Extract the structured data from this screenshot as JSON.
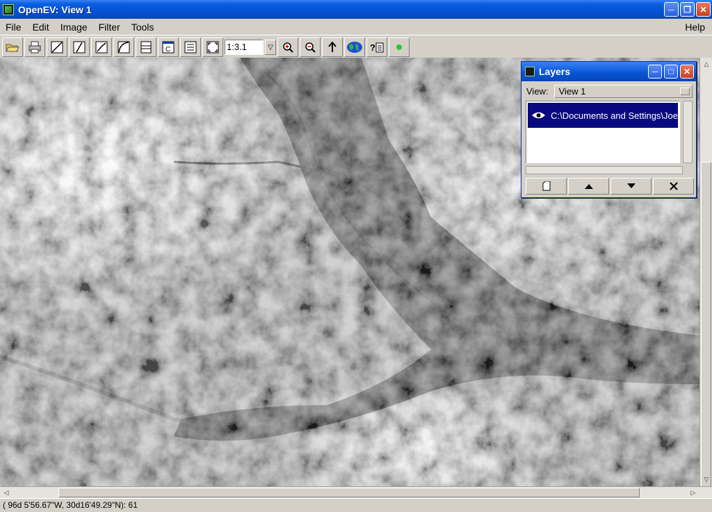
{
  "window": {
    "title": "OpenEV: View 1"
  },
  "menu": {
    "items": [
      "File",
      "Edit",
      "Image",
      "Filter",
      "Tools"
    ],
    "help": "Help"
  },
  "toolbar": {
    "zoom_value": "1:3.1",
    "buttons": [
      "open-icon",
      "print-icon",
      "draw-point-icon",
      "draw-line-icon",
      "draw-polygon-icon",
      "draw-arc-icon",
      "select-icon",
      "raster-icon",
      "list-icon",
      "fit-icon",
      "zoom-in-icon",
      "zoom-out-icon",
      "up-arrow-icon",
      "globe-icon",
      "help-icon",
      "indicator-icon"
    ]
  },
  "status": {
    "text": "( 96d 5'56.67\"W, 30d16'49.29\"N): 61"
  },
  "layers": {
    "title": "Layers",
    "view_label": "View:",
    "view_value": "View 1",
    "items": [
      {
        "path": "C:\\Documents and Settings\\Joe"
      }
    ],
    "buttons": [
      "new-layer-icon",
      "move-up-icon",
      "move-down-icon",
      "delete-layer-icon"
    ]
  },
  "colors": {
    "titlebar": "#0553d4",
    "selection": "#0a0a80",
    "chrome": "#d4d0c8"
  }
}
